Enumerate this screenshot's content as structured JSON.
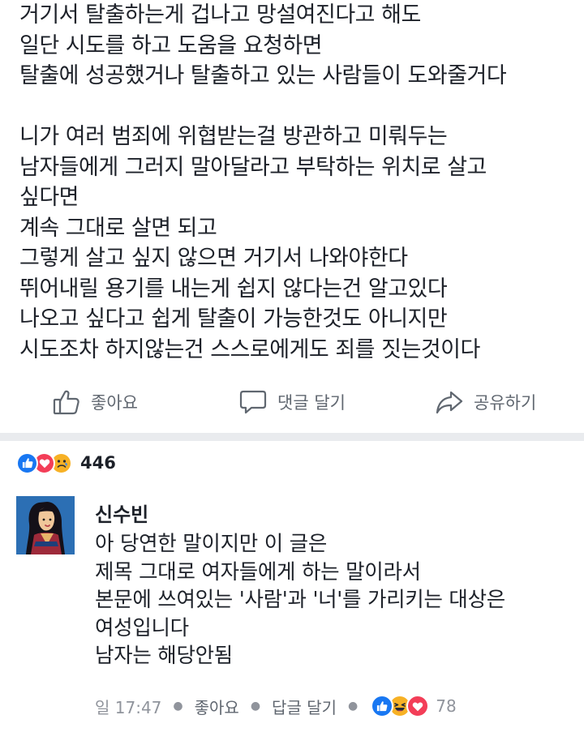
{
  "post": {
    "lines": [
      "거기서 탈출하는게 겁나고 망설여진다고 해도",
      "일단 시도를 하고 도움을 요청하면",
      "탈출에 성공했거나 탈출하고 있는 사람들이 도와줄거다",
      "",
      "니가 여러 범죄에 위협받는걸 방관하고 미뤄두는",
      "남자들에게 그러지 말아달라고 부탁하는 위치로 살고",
      "싶다면",
      "계속 그대로 살면 되고",
      "그렇게 살고 싶지 않으면 거기서 나와야한다",
      "뛰어내릴 용기를 내는게 쉽지 않다는건 알고있다",
      "나오고 싶다고 쉽게 탈출이 가능한것도 아니지만",
      "시도조차 하지않는건 스스로에게도 죄를 짓는것이다"
    ]
  },
  "actions": {
    "like": "좋아요",
    "comment": "댓글 달기",
    "share": "공유하기"
  },
  "reactions": {
    "icons": [
      "like-icon",
      "love-icon",
      "sad-icon"
    ],
    "count": "446"
  },
  "comment": {
    "author": "신수빈",
    "lines": [
      "아 당연한 말이지만 이 글은",
      "제목 그대로 여자들에게 하는 말이라서",
      "본문에 쓰여있는 '사람'과 '너'를 가리키는 대상은",
      "여성입니다",
      "남자는 해당안됨"
    ],
    "time": "일 17:47",
    "like_label": "좋아요",
    "reply_label": "답글 달기",
    "reaction_icons": [
      "like-icon",
      "haha-icon",
      "love-icon"
    ],
    "reaction_count": "78"
  },
  "colors": {
    "text": "#1d2129",
    "muted": "#606770",
    "meta": "#90949c",
    "like_blue": "#1877f2",
    "love_red": "#f33e58",
    "emoji_yellow": "#f7b125",
    "divider": "#e9ebee"
  }
}
